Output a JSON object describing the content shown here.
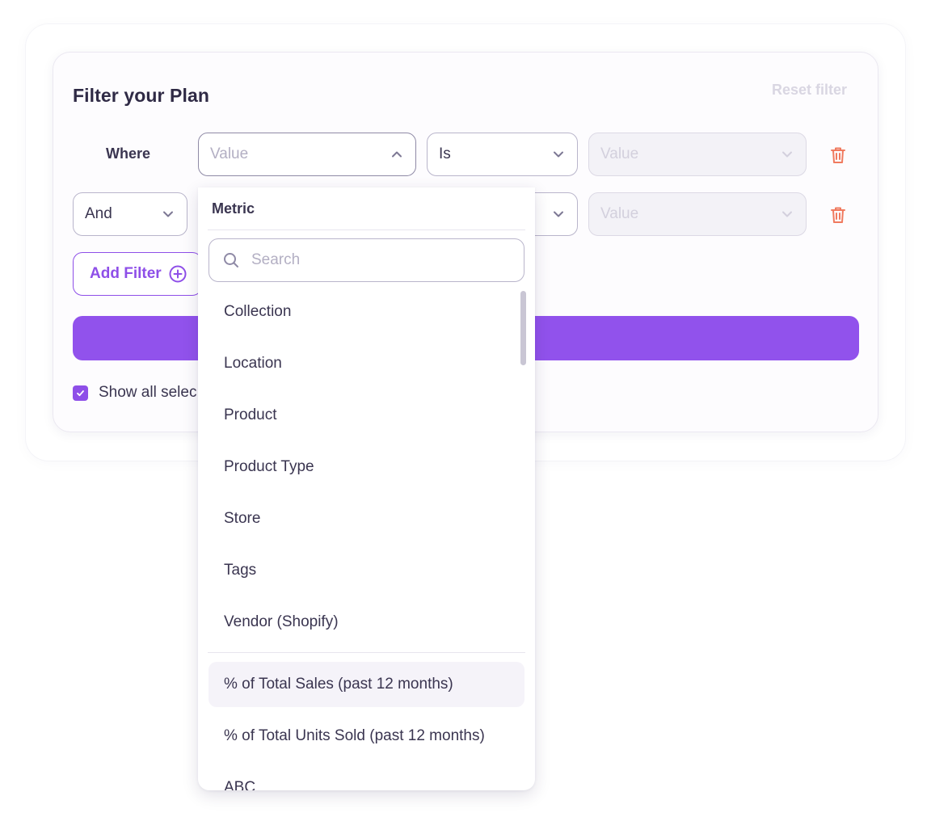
{
  "filter_panel": {
    "title": "Filter your Plan",
    "reset_label": "Reset filter",
    "where_label": "Where",
    "row1": {
      "field_placeholder": "Value",
      "operator_value": "Is",
      "value_placeholder": "Value"
    },
    "row2": {
      "conjunction_value": "And",
      "value_placeholder": "Value"
    },
    "add_filter_label": "Add Filter",
    "show_all_label": "Show all selec"
  },
  "dropdown": {
    "header": "Metric",
    "search_placeholder": "Search",
    "attribute_items": [
      "Collection",
      "Location",
      "Product",
      "Product Type",
      "Store",
      "Tags",
      "Vendor (Shopify)"
    ],
    "metric_items": [
      "% of Total Sales (past 12 months)",
      "% of Total Units Sold (past 12 months)",
      "ABC"
    ]
  },
  "colors": {
    "accent": "#8e4fe8",
    "danger": "#f07a5f",
    "text": "#2f2a45"
  }
}
